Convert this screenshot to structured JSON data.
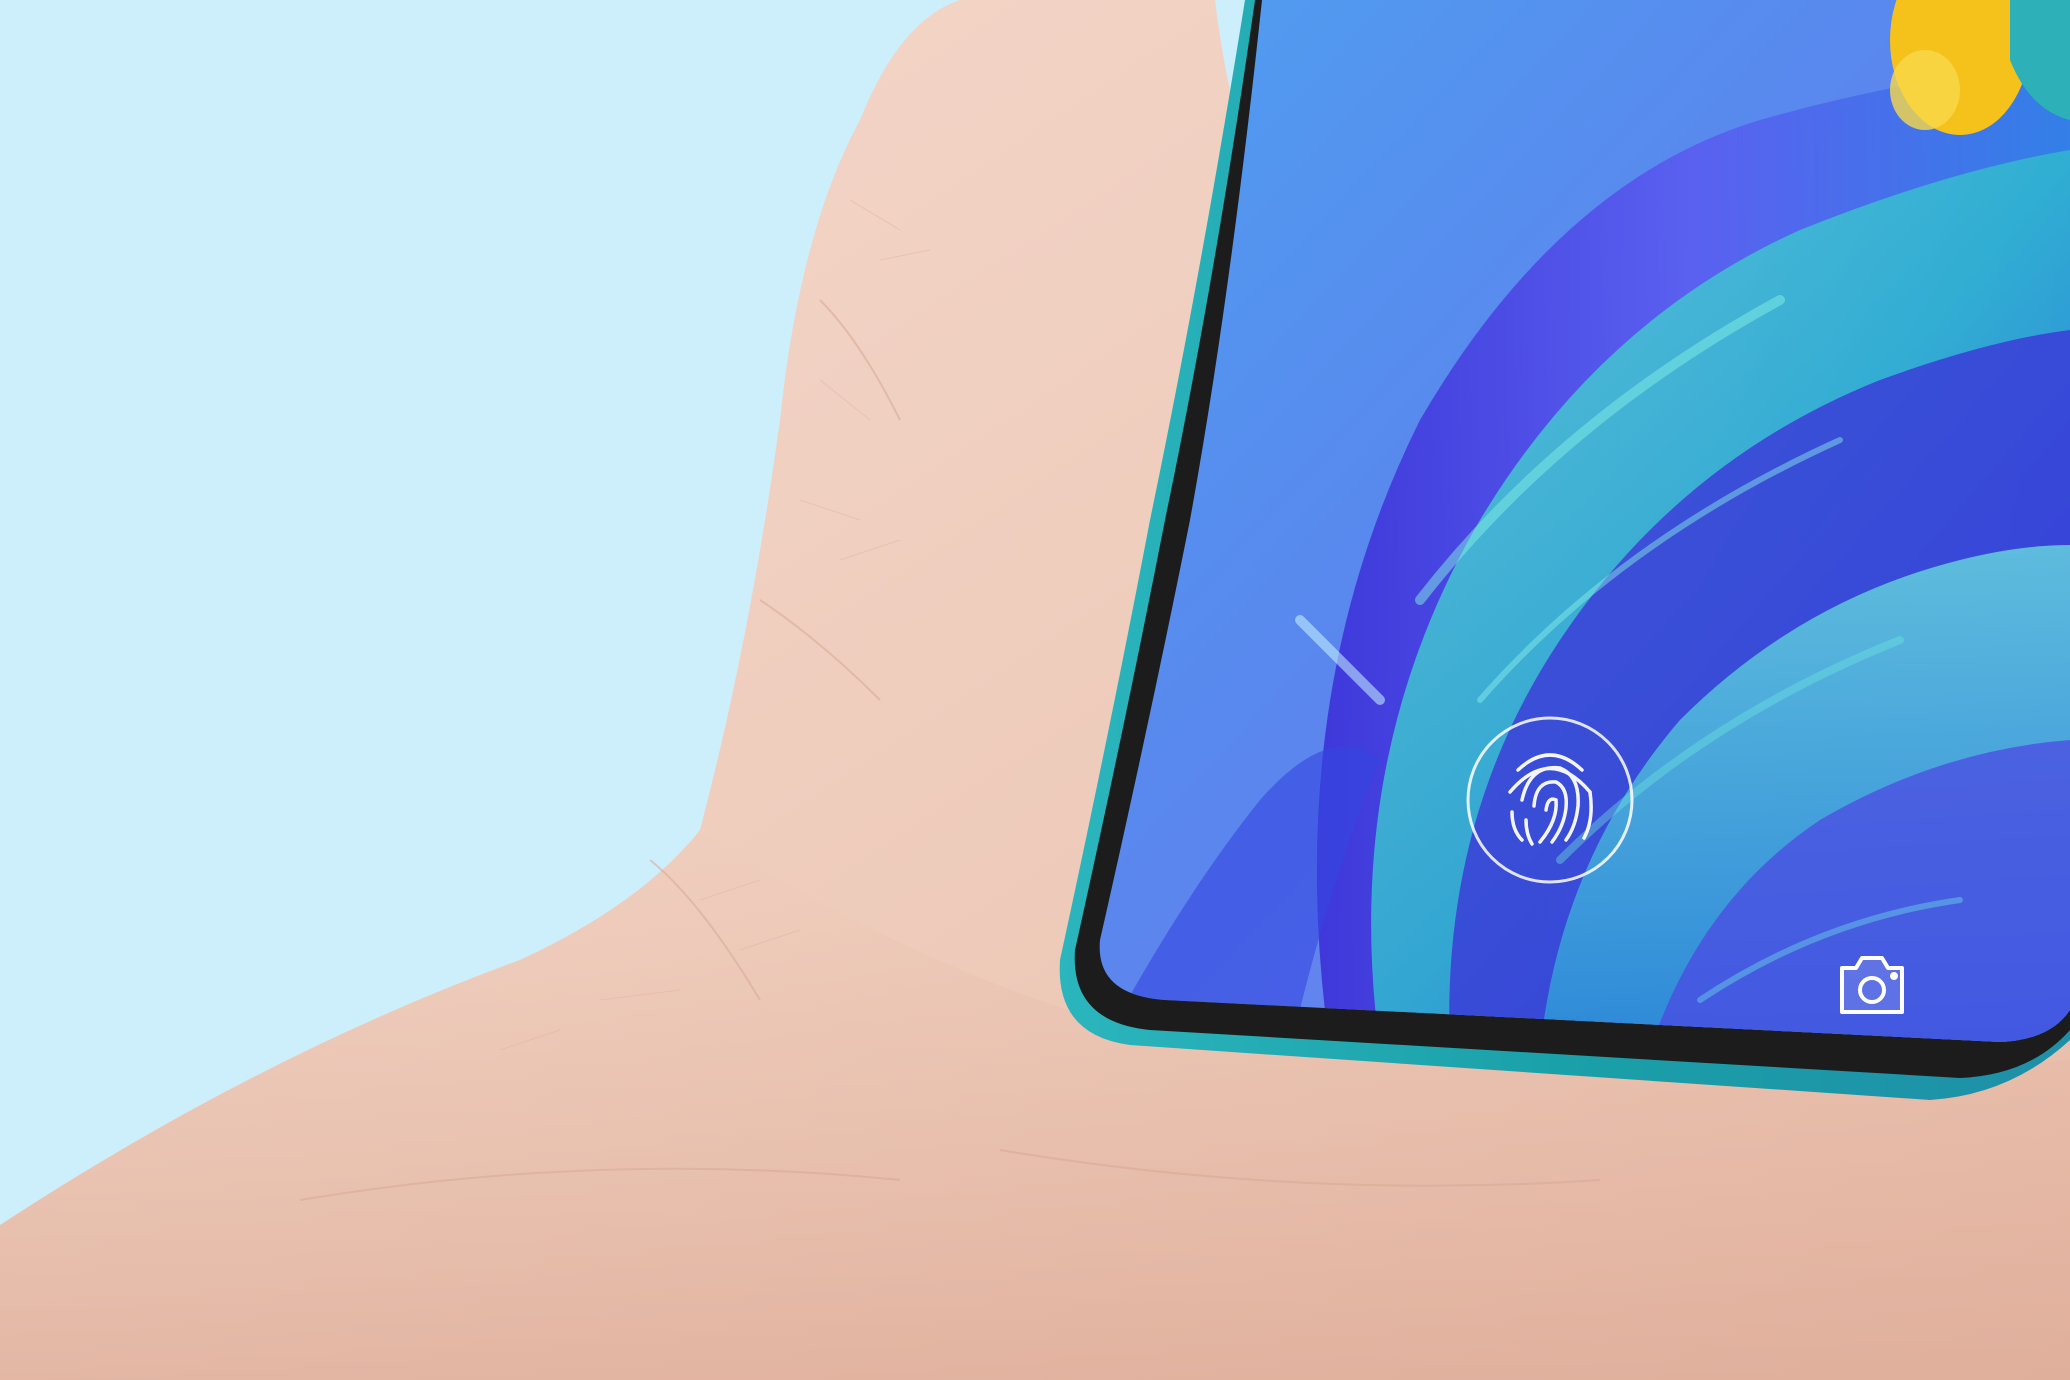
{
  "scene": {
    "background_color": "#cdeefb",
    "skin_color": "#efcdbd",
    "phone_frame_color": "#1ea7ad",
    "bezel_color": "#1c1c1c"
  },
  "screen": {
    "wallpaper_colors": [
      "#4a8ff0",
      "#3b2fd8",
      "#5fd3d6",
      "#2f6de8",
      "#f5c21b"
    ]
  },
  "fingerprint_sensor": {
    "icon": "fingerprint-icon"
  },
  "camera_shortcut": {
    "icon": "camera-icon"
  }
}
